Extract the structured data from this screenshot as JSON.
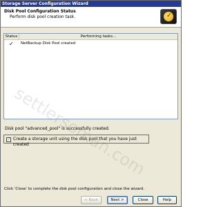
{
  "window": {
    "title": "Storage Server Configuration Wizard"
  },
  "header": {
    "title": "Disk Pool Configuration Status",
    "subtitle": "Perform disk pool creation task."
  },
  "table": {
    "columns": [
      "Status",
      "Performing tasks..."
    ],
    "rows": [
      {
        "status_icon": "checkmark-icon",
        "status_glyph": "✓",
        "task": "NetBackup Disk Pool created"
      }
    ]
  },
  "status": {
    "message": "Disk pool \"advanced_pool\" is successfully created."
  },
  "option": {
    "checked": true,
    "check_glyph": "✓",
    "label": "Create a storage unit using the disk pool that you have just created"
  },
  "footer": {
    "instruction": "Click 'Close' to complete the disk pool configuration and close the wizard."
  },
  "buttons": {
    "back": "< Back",
    "next": "Next >",
    "close": "Close",
    "help": "Help"
  },
  "watermark": {
    "text": "settlersoman.com"
  },
  "colors": {
    "titlebar": "#243a9a",
    "highlight_border": "#e03a3a",
    "dialog_bg": "#ece9d8"
  }
}
